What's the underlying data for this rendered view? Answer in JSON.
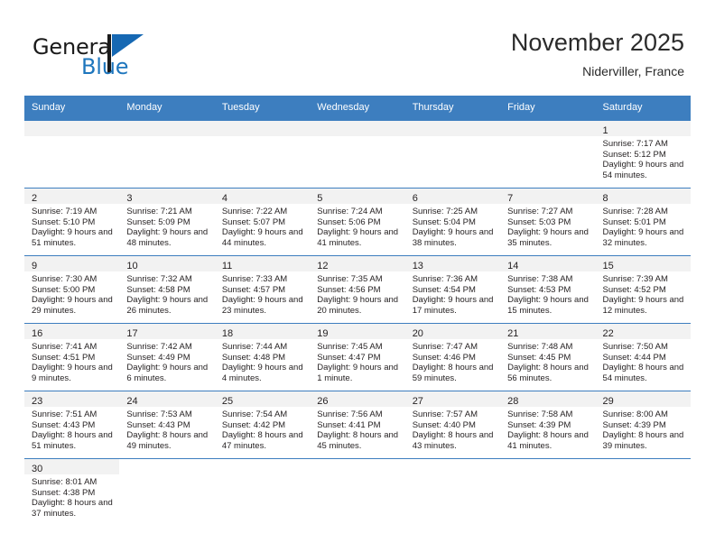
{
  "brand": {
    "name_top": "General",
    "name_bottom": "Blue",
    "flag_icon": "general-blue-flag-icon",
    "accent_color": "#1e76bd"
  },
  "header": {
    "title": "November 2025",
    "subtitle": "Niderviller, France"
  },
  "colors": {
    "header_row": "#3d7ebf",
    "daynum_band": "#f2f2f2",
    "text": "#231f20"
  },
  "weekday_headers": [
    "Sunday",
    "Monday",
    "Tuesday",
    "Wednesday",
    "Thursday",
    "Friday",
    "Saturday"
  ],
  "weeks": [
    [
      {
        "day": "",
        "lines": []
      },
      {
        "day": "",
        "lines": []
      },
      {
        "day": "",
        "lines": []
      },
      {
        "day": "",
        "lines": []
      },
      {
        "day": "",
        "lines": []
      },
      {
        "day": "",
        "lines": []
      },
      {
        "day": "1",
        "lines": [
          "Sunrise: 7:17 AM",
          "Sunset: 5:12 PM",
          "Daylight: 9 hours and 54 minutes."
        ]
      }
    ],
    [
      {
        "day": "2",
        "lines": [
          "Sunrise: 7:19 AM",
          "Sunset: 5:10 PM",
          "Daylight: 9 hours and 51 minutes."
        ]
      },
      {
        "day": "3",
        "lines": [
          "Sunrise: 7:21 AM",
          "Sunset: 5:09 PM",
          "Daylight: 9 hours and 48 minutes."
        ]
      },
      {
        "day": "4",
        "lines": [
          "Sunrise: 7:22 AM",
          "Sunset: 5:07 PM",
          "Daylight: 9 hours and 44 minutes."
        ]
      },
      {
        "day": "5",
        "lines": [
          "Sunrise: 7:24 AM",
          "Sunset: 5:06 PM",
          "Daylight: 9 hours and 41 minutes."
        ]
      },
      {
        "day": "6",
        "lines": [
          "Sunrise: 7:25 AM",
          "Sunset: 5:04 PM",
          "Daylight: 9 hours and 38 minutes."
        ]
      },
      {
        "day": "7",
        "lines": [
          "Sunrise: 7:27 AM",
          "Sunset: 5:03 PM",
          "Daylight: 9 hours and 35 minutes."
        ]
      },
      {
        "day": "8",
        "lines": [
          "Sunrise: 7:28 AM",
          "Sunset: 5:01 PM",
          "Daylight: 9 hours and 32 minutes."
        ]
      }
    ],
    [
      {
        "day": "9",
        "lines": [
          "Sunrise: 7:30 AM",
          "Sunset: 5:00 PM",
          "Daylight: 9 hours and 29 minutes."
        ]
      },
      {
        "day": "10",
        "lines": [
          "Sunrise: 7:32 AM",
          "Sunset: 4:58 PM",
          "Daylight: 9 hours and 26 minutes."
        ]
      },
      {
        "day": "11",
        "lines": [
          "Sunrise: 7:33 AM",
          "Sunset: 4:57 PM",
          "Daylight: 9 hours and 23 minutes."
        ]
      },
      {
        "day": "12",
        "lines": [
          "Sunrise: 7:35 AM",
          "Sunset: 4:56 PM",
          "Daylight: 9 hours and 20 minutes."
        ]
      },
      {
        "day": "13",
        "lines": [
          "Sunrise: 7:36 AM",
          "Sunset: 4:54 PM",
          "Daylight: 9 hours and 17 minutes."
        ]
      },
      {
        "day": "14",
        "lines": [
          "Sunrise: 7:38 AM",
          "Sunset: 4:53 PM",
          "Daylight: 9 hours and 15 minutes."
        ]
      },
      {
        "day": "15",
        "lines": [
          "Sunrise: 7:39 AM",
          "Sunset: 4:52 PM",
          "Daylight: 9 hours and 12 minutes."
        ]
      }
    ],
    [
      {
        "day": "16",
        "lines": [
          "Sunrise: 7:41 AM",
          "Sunset: 4:51 PM",
          "Daylight: 9 hours and 9 minutes."
        ]
      },
      {
        "day": "17",
        "lines": [
          "Sunrise: 7:42 AM",
          "Sunset: 4:49 PM",
          "Daylight: 9 hours and 6 minutes."
        ]
      },
      {
        "day": "18",
        "lines": [
          "Sunrise: 7:44 AM",
          "Sunset: 4:48 PM",
          "Daylight: 9 hours and 4 minutes."
        ]
      },
      {
        "day": "19",
        "lines": [
          "Sunrise: 7:45 AM",
          "Sunset: 4:47 PM",
          "Daylight: 9 hours and 1 minute."
        ]
      },
      {
        "day": "20",
        "lines": [
          "Sunrise: 7:47 AM",
          "Sunset: 4:46 PM",
          "Daylight: 8 hours and 59 minutes."
        ]
      },
      {
        "day": "21",
        "lines": [
          "Sunrise: 7:48 AM",
          "Sunset: 4:45 PM",
          "Daylight: 8 hours and 56 minutes."
        ]
      },
      {
        "day": "22",
        "lines": [
          "Sunrise: 7:50 AM",
          "Sunset: 4:44 PM",
          "Daylight: 8 hours and 54 minutes."
        ]
      }
    ],
    [
      {
        "day": "23",
        "lines": [
          "Sunrise: 7:51 AM",
          "Sunset: 4:43 PM",
          "Daylight: 8 hours and 51 minutes."
        ]
      },
      {
        "day": "24",
        "lines": [
          "Sunrise: 7:53 AM",
          "Sunset: 4:43 PM",
          "Daylight: 8 hours and 49 minutes."
        ]
      },
      {
        "day": "25",
        "lines": [
          "Sunrise: 7:54 AM",
          "Sunset: 4:42 PM",
          "Daylight: 8 hours and 47 minutes."
        ]
      },
      {
        "day": "26",
        "lines": [
          "Sunrise: 7:56 AM",
          "Sunset: 4:41 PM",
          "Daylight: 8 hours and 45 minutes."
        ]
      },
      {
        "day": "27",
        "lines": [
          "Sunrise: 7:57 AM",
          "Sunset: 4:40 PM",
          "Daylight: 8 hours and 43 minutes."
        ]
      },
      {
        "day": "28",
        "lines": [
          "Sunrise: 7:58 AM",
          "Sunset: 4:39 PM",
          "Daylight: 8 hours and 41 minutes."
        ]
      },
      {
        "day": "29",
        "lines": [
          "Sunrise: 8:00 AM",
          "Sunset: 4:39 PM",
          "Daylight: 8 hours and 39 minutes."
        ]
      }
    ],
    [
      {
        "day": "30",
        "lines": [
          "Sunrise: 8:01 AM",
          "Sunset: 4:38 PM",
          "Daylight: 8 hours and 37 minutes."
        ]
      },
      {
        "day": "",
        "lines": []
      },
      {
        "day": "",
        "lines": []
      },
      {
        "day": "",
        "lines": []
      },
      {
        "day": "",
        "lines": []
      },
      {
        "day": "",
        "lines": []
      },
      {
        "day": "",
        "lines": []
      }
    ]
  ]
}
